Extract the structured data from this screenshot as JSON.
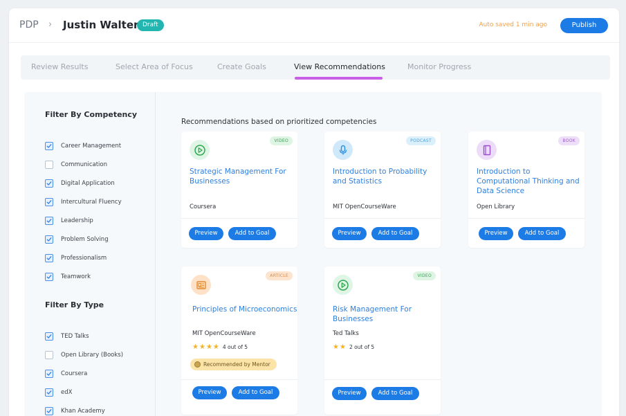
{
  "header": {
    "breadcrumb_root": "PDP",
    "breadcrumb_sep": "›",
    "name": "Justin Walters",
    "status_badge": "Draft",
    "autosave": "Auto saved 1 min ago",
    "publish_label": "Publish"
  },
  "tabs": [
    {
      "label": "Review Results",
      "active": false
    },
    {
      "label": "Select Area of Focus",
      "active": false
    },
    {
      "label": "Create Goals",
      "active": false
    },
    {
      "label": "View Recommendations",
      "active": true
    },
    {
      "label": "Monitor Progress",
      "active": false
    }
  ],
  "filters": {
    "competency_title": "Filter By Competency",
    "competencies": [
      {
        "label": "Career Management",
        "checked": true
      },
      {
        "label": "Communication",
        "checked": false
      },
      {
        "label": "Digital Application",
        "checked": true
      },
      {
        "label": "Intercultural Fluency",
        "checked": true
      },
      {
        "label": "Leadership",
        "checked": true
      },
      {
        "label": "Problem Solving",
        "checked": true
      },
      {
        "label": "Professionalism",
        "checked": true
      },
      {
        "label": "Teamwork",
        "checked": true
      }
    ],
    "type_title": "Filter By Type",
    "types": [
      {
        "label": "TED Talks",
        "checked": true
      },
      {
        "label": "Open Library (Books)",
        "checked": false
      },
      {
        "label": "Coursera",
        "checked": true
      },
      {
        "label": "edX",
        "checked": true
      },
      {
        "label": "Khan Academy",
        "checked": true
      }
    ]
  },
  "recommendations": {
    "heading": "Recommendations based on prioritized competencies",
    "preview_label": "Preview",
    "add_label": "Add to Goal",
    "cards": [
      {
        "type": "VIDEO",
        "icon": "play-icon",
        "title": "Strategic Management For Businesses",
        "provider": "Coursera"
      },
      {
        "type": "PODCAST",
        "icon": "microphone-icon",
        "title": "Introduction to Probability and Statistics",
        "provider": "MIT OpenCourseWare"
      },
      {
        "type": "BOOK",
        "icon": "book-icon",
        "title": "Introduction to Computational Thinking and Data Science",
        "provider": "Open Library"
      },
      {
        "type": "ARTICLE",
        "icon": "article-icon",
        "title": "Principles of Microeconomics",
        "provider": "MIT OpenCourseWare",
        "rating": 4,
        "rating_text": "4 out of 5",
        "mentor_badge": "Recommended by Mentor"
      },
      {
        "type": "VIDEO",
        "icon": "play-icon",
        "title": "Risk Management For Businesses",
        "provider": "Ted Talks",
        "rating": 2,
        "rating_text": "2 out of 5"
      }
    ]
  },
  "colors": {
    "primary": "#1d7be6",
    "draft": "#23b6b0",
    "autosave": "#f0a04b",
    "tab_active_underline": "#c85fe6",
    "star": "#f5b224",
    "video_badge_bg": "#def5e3",
    "podcast_badge_bg": "#dcf0fb",
    "book_badge_bg": "#eedff8",
    "article_badge_bg": "#fde4cf"
  }
}
